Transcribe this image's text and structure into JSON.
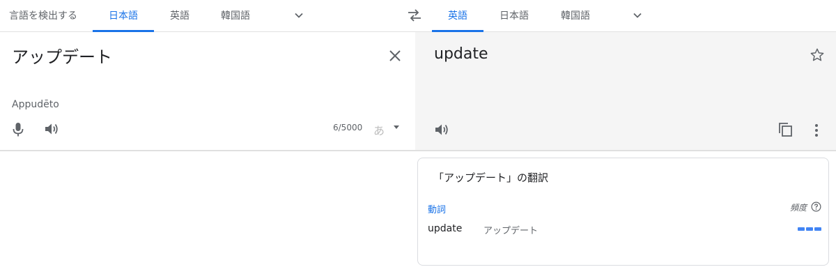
{
  "source_tabs": [
    {
      "label": "言語を検出する",
      "active": false
    },
    {
      "label": "日本語",
      "active": true
    },
    {
      "label": "英語",
      "active": false
    },
    {
      "label": "韓国語",
      "active": false
    }
  ],
  "target_tabs": [
    {
      "label": "英語",
      "active": true
    },
    {
      "label": "日本語",
      "active": false
    },
    {
      "label": "韓国語",
      "active": false
    }
  ],
  "source": {
    "text": "アップデート",
    "romanization": "Appudēto",
    "char_count": "6/5000",
    "ime_label": "あ"
  },
  "target": {
    "text": "update"
  },
  "dictionary": {
    "title": "「アップデート」の翻訳",
    "part_of_speech": "動詞",
    "frequency_label": "頻度",
    "entries": [
      {
        "word": "update",
        "translation": "アップデート",
        "frequency": 3
      }
    ]
  },
  "colors": {
    "accent": "#1a73e8",
    "frequency_bar": "#4285f4",
    "target_bg": "#f5f5f5"
  },
  "icons": [
    "chevron-down-icon",
    "swap-languages-icon",
    "clear-icon",
    "star-icon",
    "microphone-icon",
    "speaker-icon",
    "copy-icon",
    "more-options-icon",
    "help-icon"
  ]
}
